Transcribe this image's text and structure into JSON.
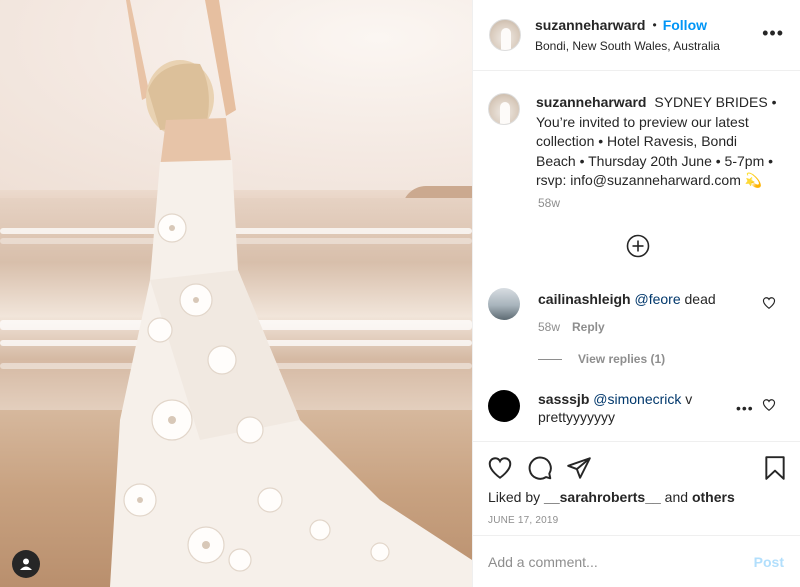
{
  "post": {
    "username": "suzanneharward",
    "follow_label": "Follow",
    "location": "Bondi, New South Wales, Australia",
    "more_label": "•••"
  },
  "caption": {
    "username": "suzanneharward",
    "text": "SYDNEY BRIDES • You’re invited to preview our latest collection • Hotel Ravesis, Bondi Beach • Thursday 20th June • 5-7pm • rsvp: info@suzanneharward.com 💫",
    "time": "58w"
  },
  "comments": [
    {
      "username": "cailinashleigh",
      "mention": "@feore",
      "text": " dead",
      "time": "58w",
      "reply_label": "Reply",
      "view_replies": "View replies (1)"
    },
    {
      "username": "sasssjb",
      "mention": "@simonecrick",
      "text": " v prettyyyyyyy",
      "more_label": "•••"
    }
  ],
  "likes": {
    "prefix": "Liked by ",
    "user": "__sarahroberts__",
    "joiner": " and ",
    "others": "others"
  },
  "date": "JUNE 17, 2019",
  "add_comment": {
    "placeholder": "Add a comment...",
    "post_label": "Post"
  },
  "colors": {
    "link_blue": "#0095f6",
    "post_disabled": "#b2dffc",
    "secondary_text": "#8e8e8e",
    "mention": "#00376b"
  },
  "icons": [
    "heart-icon",
    "comment-icon",
    "share-icon",
    "bookmark-icon",
    "add-circle-icon",
    "user-icon"
  ]
}
